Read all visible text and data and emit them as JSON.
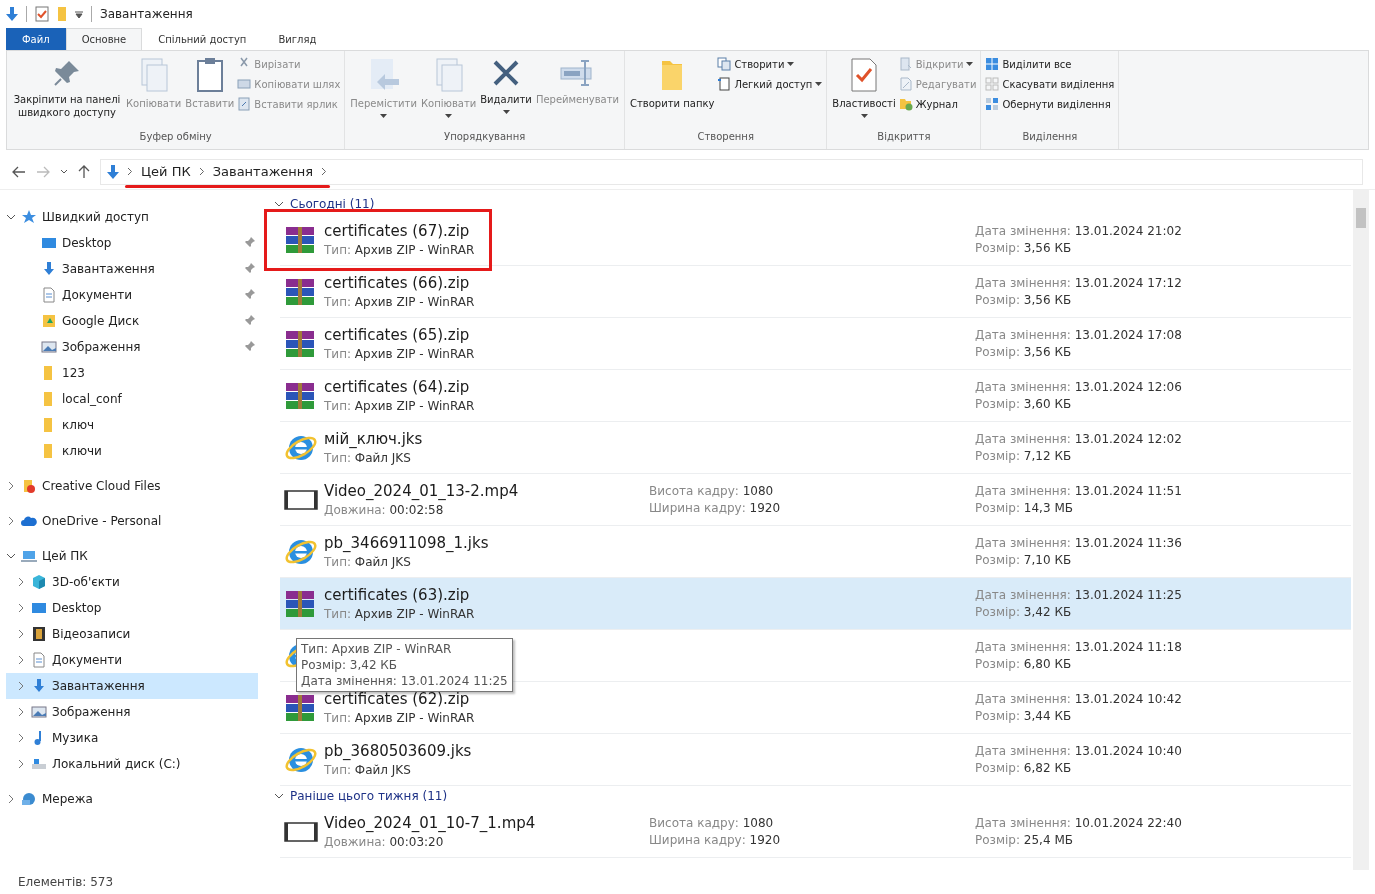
{
  "window": {
    "title": "Завантаження"
  },
  "tabs": [
    {
      "label": "Файл",
      "kind": "file",
      "selected": false
    },
    {
      "label": "Основне",
      "kind": "tab",
      "selected": true
    },
    {
      "label": "Спільний доступ",
      "kind": "tab",
      "selected": false
    },
    {
      "label": "Вигляд",
      "kind": "tab",
      "selected": false
    }
  ],
  "ribbon": [
    {
      "label": "Буфер обміну",
      "items": [
        {
          "kind": "large",
          "label": "Закріпити на панелі швидкого доступу",
          "disabled": false,
          "dropdown": false
        },
        {
          "kind": "large",
          "label": "Копіювати",
          "disabled": true,
          "dropdown": false
        },
        {
          "kind": "large",
          "label": "Вставити",
          "disabled": true,
          "dropdown": false
        },
        {
          "kind": "stack",
          "children": [
            {
              "label": "Вирізати",
              "disabled": true,
              "dropdown": false
            },
            {
              "label": "Копіювати шлях",
              "disabled": true,
              "dropdown": false
            },
            {
              "label": "Вставити ярлик",
              "disabled": true,
              "dropdown": false
            }
          ]
        }
      ]
    },
    {
      "label": "Упорядкування",
      "items": [
        {
          "kind": "large",
          "label": "Перемістити",
          "disabled": true,
          "dropdown": true
        },
        {
          "kind": "large",
          "label": "Копіювати",
          "disabled": true,
          "dropdown": true
        },
        {
          "kind": "large",
          "label": "Видалити",
          "disabled": false,
          "dropdown": true
        },
        {
          "kind": "large",
          "label": "Перейменувати",
          "disabled": true,
          "dropdown": false
        }
      ]
    },
    {
      "label": "Створення",
      "items": [
        {
          "kind": "large",
          "label": "Створити папку",
          "disabled": false,
          "dropdown": false
        },
        {
          "kind": "stack",
          "children": [
            {
              "label": "Створити",
              "disabled": false,
              "dropdown": true
            },
            {
              "label": "Легкий доступ",
              "disabled": false,
              "dropdown": true
            }
          ]
        }
      ]
    },
    {
      "label": "Відкриття",
      "items": [
        {
          "kind": "large",
          "label": "Властивості",
          "disabled": false,
          "dropdown": true
        },
        {
          "kind": "stack",
          "children": [
            {
              "label": "Відкрити",
              "disabled": true,
              "dropdown": true
            },
            {
              "label": "Редагувати",
              "disabled": true,
              "dropdown": false
            },
            {
              "label": "Журнал",
              "disabled": false,
              "dropdown": false
            }
          ]
        }
      ]
    },
    {
      "label": "Виділення",
      "items": [
        {
          "kind": "stack",
          "children": [
            {
              "label": "Виділити все",
              "disabled": false,
              "dropdown": false
            },
            {
              "label": "Скасувати виділення",
              "disabled": false,
              "dropdown": false
            },
            {
              "label": "Обернути виділення",
              "disabled": false,
              "dropdown": false
            }
          ]
        }
      ]
    }
  ],
  "address": {
    "crumbs": [
      "Цей ПК",
      "Завантаження"
    ],
    "underlined": true
  },
  "sidebar": [
    {
      "label": "Швидкий доступ",
      "expanded": true,
      "selected": false,
      "children": [
        {
          "label": "Desktop",
          "pinned": true,
          "selected": false
        },
        {
          "label": "Завантаження",
          "pinned": true,
          "selected": false
        },
        {
          "label": "Документи",
          "pinned": true,
          "selected": false
        },
        {
          "label": "Google Диск",
          "pinned": true,
          "selected": false
        },
        {
          "label": "Зображення",
          "pinned": true,
          "selected": false
        },
        {
          "label": "123",
          "pinned": false,
          "selected": false
        },
        {
          "label": "local_conf",
          "pinned": false,
          "selected": false
        },
        {
          "label": "ключ",
          "pinned": false,
          "selected": false
        },
        {
          "label": "ключи",
          "pinned": false,
          "selected": false
        }
      ]
    },
    {
      "label": "Creative Cloud Files",
      "expanded": false,
      "selected": false
    },
    {
      "label": "OneDrive - Personal",
      "expanded": false,
      "selected": false
    },
    {
      "label": "Цей ПК",
      "expanded": true,
      "selected": false,
      "children": [
        {
          "label": "3D-об'єкти",
          "expanded": false,
          "selected": false
        },
        {
          "label": "Desktop",
          "expanded": false,
          "selected": false
        },
        {
          "label": "Відеозаписи",
          "expanded": false,
          "selected": false
        },
        {
          "label": "Документи",
          "expanded": false,
          "selected": false
        },
        {
          "label": "Завантаження",
          "expanded": false,
          "selected": true
        },
        {
          "label": "Зображення",
          "expanded": false,
          "selected": false
        },
        {
          "label": "Музика",
          "expanded": false,
          "selected": false
        },
        {
          "label": "Локальний диск (C:)",
          "expanded": false,
          "selected": false
        }
      ]
    },
    {
      "label": "Мережа",
      "expanded": false,
      "selected": false
    }
  ],
  "groups": [
    {
      "label": "Сьогодні (11)",
      "expanded": true,
      "items": [
        {
          "kind": "zip",
          "name": "certificates (67).zip",
          "type": [
            "Тип:",
            "Архив ZIP - WinRAR"
          ],
          "date": [
            "Дата змінення:",
            "13.01.2024 21:02"
          ],
          "size": [
            "Розмір:",
            "3,56 КБ"
          ],
          "outlined": true,
          "selected": false
        },
        {
          "kind": "zip",
          "name": "certificates (66).zip",
          "type": [
            "Тип:",
            "Архив ZIP - WinRAR"
          ],
          "date": [
            "Дата змінення:",
            "13.01.2024 17:12"
          ],
          "size": [
            "Розмір:",
            "3,56 КБ"
          ],
          "outlined": false,
          "selected": false
        },
        {
          "kind": "zip",
          "name": "certificates (65).zip",
          "type": [
            "Тип:",
            "Архив ZIP - WinRAR"
          ],
          "date": [
            "Дата змінення:",
            "13.01.2024 17:08"
          ],
          "size": [
            "Розмір:",
            "3,56 КБ"
          ],
          "outlined": false,
          "selected": false
        },
        {
          "kind": "zip",
          "name": "certificates (64).zip",
          "type": [
            "Тип:",
            "Архив ZIP - WinRAR"
          ],
          "date": [
            "Дата змінення:",
            "13.01.2024 12:06"
          ],
          "size": [
            "Розмір:",
            "3,60 КБ"
          ],
          "outlined": false,
          "selected": false
        },
        {
          "kind": "jks",
          "name": "мій_ключ.jks",
          "type": [
            "Тип:",
            "Файл JKS"
          ],
          "date": [
            "Дата змінення:",
            "13.01.2024 12:02"
          ],
          "size": [
            "Розмір:",
            "7,12 КБ"
          ],
          "outlined": false,
          "selected": false
        },
        {
          "kind": "video",
          "name": "Video_2024_01_13-2.mp4",
          "type": [
            "Довжина:",
            "00:02:58"
          ],
          "extra": [
            [
              "Висота кадру:",
              "1080"
            ],
            [
              "Ширина кадру:",
              "1920"
            ]
          ],
          "date": [
            "Дата змінення:",
            "13.01.2024 11:51"
          ],
          "size": [
            "Розмір:",
            "14,3 МБ"
          ],
          "outlined": false,
          "selected": false
        },
        {
          "kind": "jks",
          "name": "pb_3466911098_1.jks",
          "type": [
            "Тип:",
            "Файл JKS"
          ],
          "date": [
            "Дата змінення:",
            "13.01.2024 11:36"
          ],
          "size": [
            "Розмір:",
            "7,10 КБ"
          ],
          "outlined": false,
          "selected": false
        },
        {
          "kind": "zip",
          "name": "certificates (63).zip",
          "type": [
            "Тип:",
            "Архив ZIP - WinRAR"
          ],
          "date": [
            "Дата змінення:",
            "13.01.2024 11:25"
          ],
          "size": [
            "Розмір:",
            "3,42 КБ"
          ],
          "outlined": false,
          "selected": true
        },
        {
          "kind": "jks",
          "date": [
            "Дата змінення:",
            "13.01.2024 11:18"
          ],
          "size": [
            "Розмір:",
            "6,80 КБ"
          ],
          "outlined": false,
          "selected": false
        },
        {
          "kind": "zip",
          "name": "certificates (62).zip",
          "type": [
            "Тип:",
            "Архив ZIP - WinRAR"
          ],
          "date": [
            "Дата змінення:",
            "13.01.2024 10:42"
          ],
          "size": [
            "Розмір:",
            "3,44 КБ"
          ],
          "outlined": false,
          "selected": false
        },
        {
          "kind": "jks",
          "name": "pb_3680503609.jks",
          "type": [
            "Тип:",
            "Файл JKS"
          ],
          "date": [
            "Дата змінення:",
            "13.01.2024 10:40"
          ],
          "size": [
            "Розмір:",
            "6,82 КБ"
          ],
          "outlined": false,
          "selected": false
        }
      ]
    },
    {
      "label": "Раніше цього тижня (11)",
      "expanded": true,
      "items": [
        {
          "kind": "video",
          "name": "Video_2024_01_10-7_1.mp4",
          "type": [
            "Довжина:",
            "00:03:20"
          ],
          "extra": [
            [
              "Висота кадру:",
              "1080"
            ],
            [
              "Ширина кадру:",
              "1920"
            ]
          ],
          "date": [
            "Дата змінення:",
            "10.01.2024 22:40"
          ],
          "size": [
            "Розмір:",
            "25,4 МБ"
          ],
          "outlined": false,
          "selected": false
        }
      ]
    }
  ],
  "tooltip": {
    "lines": [
      "Тип: Архив ZIP - WinRAR",
      "Розмір: 3,42 КБ",
      "Дата змінення: 13.01.2024 11:25"
    ]
  },
  "status_bar": {
    "count": "Елементів: 573"
  }
}
